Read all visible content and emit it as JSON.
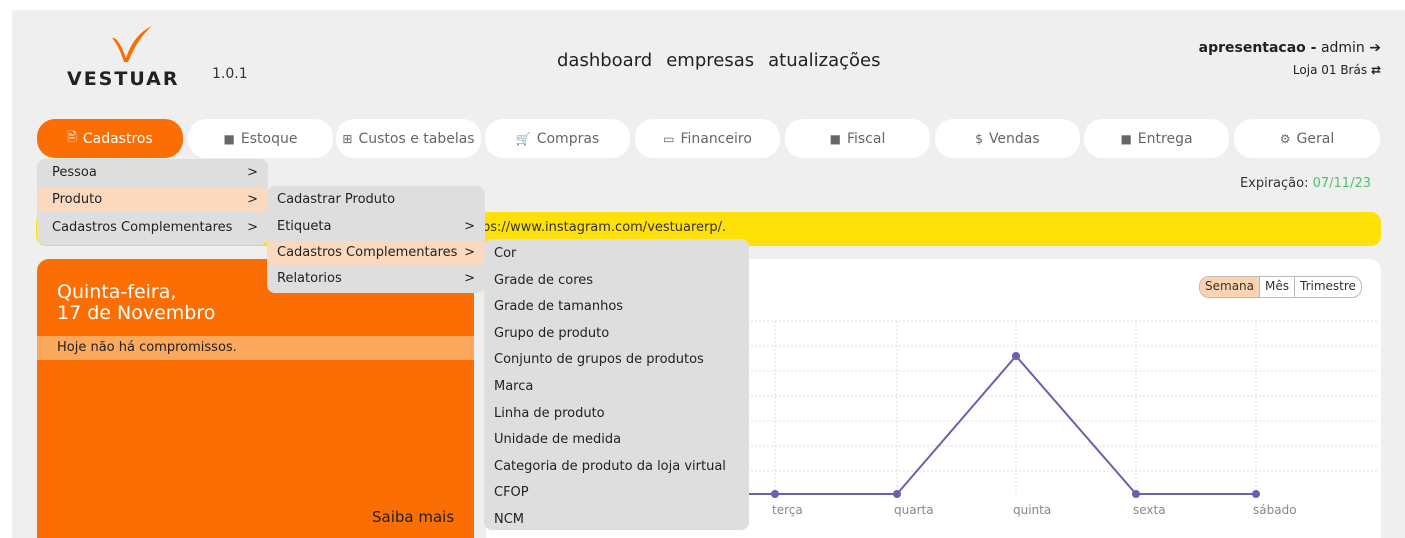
{
  "brand": {
    "logo_text": "VESTUAR",
    "version": "1.0.1",
    "accent": "#fb6e04"
  },
  "topnav": [
    "dashboard",
    "empresas",
    "atualizações"
  ],
  "user": {
    "name": "apresentacao -",
    "role": "admin",
    "logout_icon": "sign-out-icon",
    "store": "Loja 01 Brás",
    "switch_icon": "retweet-icon"
  },
  "tabs": [
    {
      "label": "Cadastros",
      "icon": "file-text-icon"
    },
    {
      "label": "Estoque",
      "icon": "truck-icon"
    },
    {
      "label": "Custos e tabelas",
      "icon": "table-icon"
    },
    {
      "label": "Compras",
      "icon": "cart-icon"
    },
    {
      "label": "Financeiro",
      "icon": "credit-card-icon"
    },
    {
      "label": "Fiscal",
      "icon": "file-icon"
    },
    {
      "label": "Vendas",
      "icon": "dollar-icon"
    },
    {
      "label": "Entrega",
      "icon": "truck-icon"
    },
    {
      "label": "Geral",
      "icon": "gears-icon"
    }
  ],
  "expiration": {
    "label": "Expiração:",
    "date": "07/11/23",
    "color": "#4cc66e"
  },
  "banner": {
    "link": "ps://www.instagram.com/vestuarerp/",
    "suffix": "."
  },
  "calendar": {
    "weekday": "Quinta-feira,",
    "date": "17 de Novembro",
    "empty": "Hoje não há compromissos.",
    "more": "Saiba mais"
  },
  "chart_controls": [
    "Semana",
    "Mês",
    "Trimestre"
  ],
  "menus": {
    "level1": [
      {
        "label": "Pessoa",
        "arrow": ">"
      },
      {
        "label": "Produto",
        "arrow": ">"
      },
      {
        "label": "Cadastros Complementares",
        "arrow": ">"
      }
    ],
    "level2": [
      {
        "label": "Cadastrar Produto",
        "arrow": ""
      },
      {
        "label": "Etiqueta",
        "arrow": ">"
      },
      {
        "label": "Cadastros Complementares",
        "arrow": ">"
      },
      {
        "label": "Relatorios",
        "arrow": ">"
      }
    ],
    "level3": [
      "Cor",
      "Grade de cores",
      "Grade de tamanhos",
      "Grupo de produto",
      "Conjunto de grupos de produtos",
      "Marca",
      "Linha de produto",
      "Unidade de medida",
      "Categoria de produto da loja virtual",
      "CFOP",
      "NCM"
    ]
  },
  "chart_data": {
    "type": "line",
    "categories": [
      "terça",
      "quarta",
      "quinta",
      "sexta",
      "sábado"
    ],
    "series": [
      {
        "values": [
          0,
          0,
          5,
          0,
          0
        ],
        "color": "#6a5fb0"
      }
    ],
    "grid": true
  }
}
